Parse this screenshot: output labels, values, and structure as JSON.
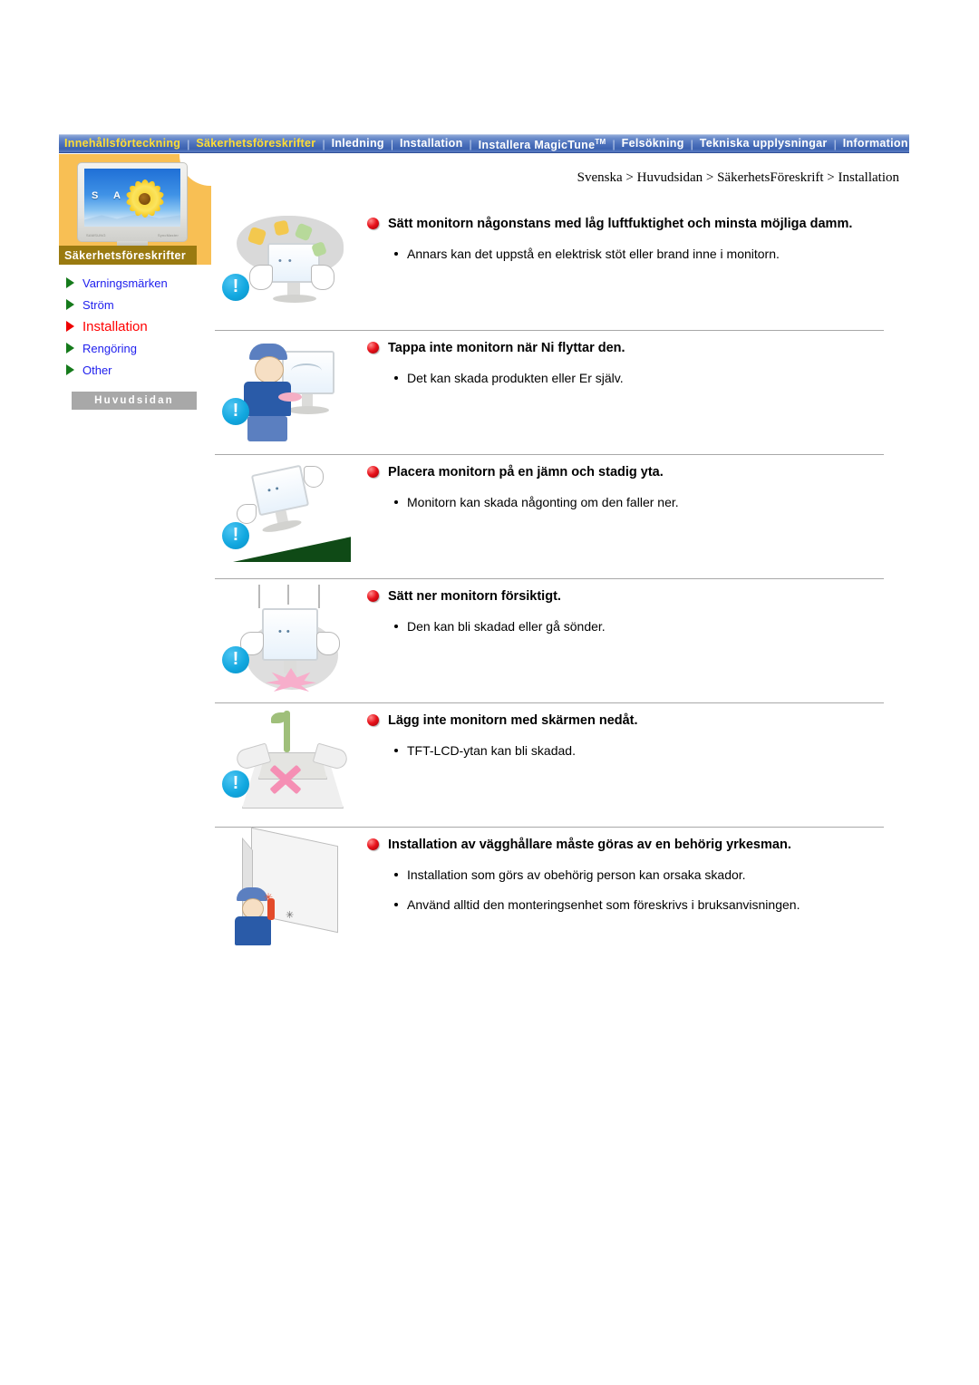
{
  "nav": {
    "items": [
      {
        "label": "Innehållsförteckning",
        "highlight": true
      },
      {
        "label": "Säkerhetsföreskrifter",
        "highlight": true
      },
      {
        "label": "Inledning",
        "highlight": false
      },
      {
        "label": "Installation",
        "highlight": false
      },
      {
        "label": "Installera MagicTune",
        "tm": "TM",
        "highlight": false
      },
      {
        "label": "Felsökning",
        "highlight": false
      },
      {
        "label": "Tekniska upplysningar",
        "highlight": false
      },
      {
        "label": "Information",
        "highlight": false
      }
    ],
    "separator": "|"
  },
  "colors": {
    "nav_bg": "#4a6fba",
    "nav_highlight": "#ffdd33",
    "sidebar_panel": "#f8bf54",
    "sidebar_title_bar": "#9a7a10",
    "active_item": "#ff0000",
    "link": "#2020ee",
    "arrow_green": "#157a1b",
    "bullet_red": "#e8121b",
    "warn_circle": "#12a8e0",
    "divider": "#a8a8a8",
    "home_button": "#a8a8a8"
  },
  "sidebar": {
    "title": "Säkerhetsföreskrifter",
    "monitor_screen_text": "S A M",
    "monitor_brand_left": "SAMSUNG",
    "monitor_brand_right": "SyncMaster",
    "items": [
      {
        "label": "Varningsmärken",
        "active": false
      },
      {
        "label": "Ström",
        "active": false
      },
      {
        "label": "Installation",
        "active": true
      },
      {
        "label": "Rengöring",
        "active": false
      },
      {
        "label": "Other",
        "active": false
      }
    ],
    "home_button": "Huvudsidan"
  },
  "breadcrumb": "Svenska > Huvudsidan > SäkerhetsFöreskrift > Installation",
  "sections": [
    {
      "heading": "Sätt monitorn någonstans med låg luftfuktighet och minsta möjliga damm.",
      "bullets": [
        "Annars kan det uppstå en elektrisk stöt eller brand inne i monitorn."
      ],
      "illustration": "monitor-dust-cloud",
      "warn_icon": "!"
    },
    {
      "heading": "Tappa inte monitorn när Ni flyttar den.",
      "bullets": [
        "Det kan skada produkten eller Er själv."
      ],
      "illustration": "person-carrying-monitor",
      "warn_icon": "!"
    },
    {
      "heading": "Placera monitorn på en jämn och stadig yta.",
      "bullets": [
        "Monitorn kan skada någonting om den faller ner."
      ],
      "illustration": "monitor-on-slope",
      "warn_icon": "!"
    },
    {
      "heading": "Sätt ner monitorn försiktigt.",
      "bullets": [
        "Den kan bli skadad eller gå sönder."
      ],
      "illustration": "monitor-dropped-impact",
      "warn_icon": "!"
    },
    {
      "heading": "Lägg inte monitorn med skärmen nedåt.",
      "bullets": [
        "TFT-LCD-ytan kan bli skadad."
      ],
      "illustration": "monitor-face-down-x",
      "warn_icon": "!"
    },
    {
      "heading": "Installation av vägghållare måste göras av en behörig yrkesman.",
      "bullets": [
        "Installation som görs av obehörig person kan orsaka skador.",
        "Använd alltid den monteringsenhet som föreskrivs i bruksanvisningen."
      ],
      "illustration": "wall-mount-installer",
      "warn_icon": ""
    }
  ]
}
